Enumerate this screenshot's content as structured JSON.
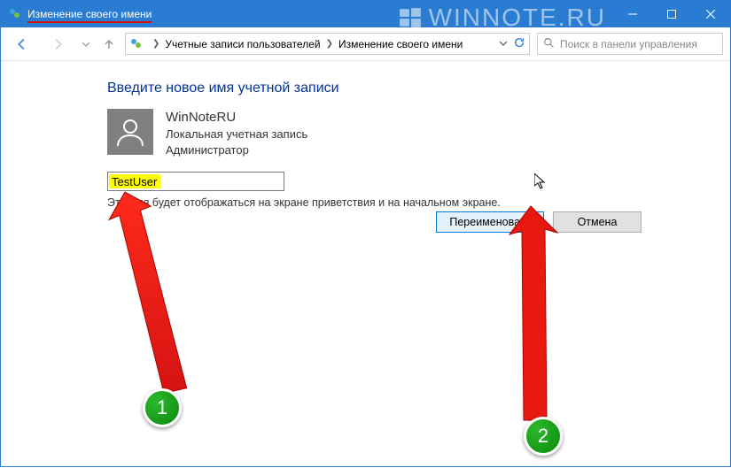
{
  "window": {
    "title": "Изменение своего имени"
  },
  "watermark": "WINNOTE.RU",
  "breadcrumb": {
    "item1": "Учетные записи пользователей",
    "item2": "Изменение своего имени"
  },
  "search": {
    "placeholder": "Поиск в панели управления"
  },
  "page": {
    "heading": "Введите новое имя учетной записи",
    "account_name": "WinNoteRU",
    "account_type": "Локальная учетная запись",
    "account_role": "Администратор",
    "input_value": "TestUser",
    "description": "Это имя будет отображаться на экране приветствия и на начальном экране.",
    "rename_button": "Переименовать",
    "cancel_button": "Отмена"
  },
  "annotations": {
    "badge1": "1",
    "badge2": "2"
  }
}
